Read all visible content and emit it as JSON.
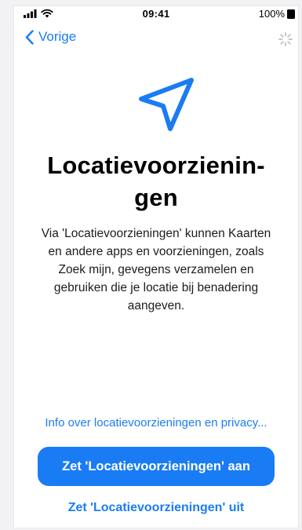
{
  "status_bar": {
    "time": "09:41",
    "battery_text": "100%",
    "signal_icon": "cellular-signal-icon",
    "wifi_icon": "wifi-icon",
    "battery_icon": "battery-icon"
  },
  "nav": {
    "back_label": "Vorige",
    "back_icon": "chevron-left-icon",
    "loading_icon": "activity-spinner-icon"
  },
  "hero": {
    "icon": "location-arrow-icon",
    "accent_color": "#1a7cf5"
  },
  "title_line1": "Locatievoorzienin-",
  "title_line2": "gen",
  "description": {
    "line1": "Via 'Locatievoorzieningen' kunnen Kaarten",
    "line2": "en andere apps en voorzieningen, zoals",
    "line3": "Zoek mijn, gevegens verzamelen en",
    "line4": "gebruiken die je locatie bij benadering",
    "line5": "aangeven."
  },
  "info_link": "Info over locatievoorzieningen en privacy...",
  "primary_button": "Zet 'Locatievoorzieningen' aan",
  "secondary_button": "Zet 'Locatievoorzieningen' uit"
}
